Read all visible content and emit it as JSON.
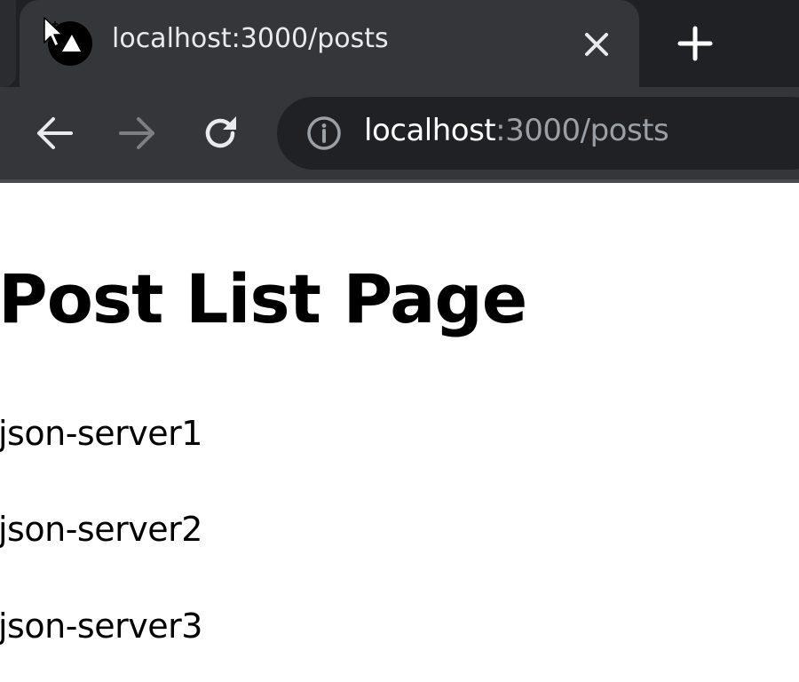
{
  "browser": {
    "tab": {
      "title": "localhost:3000/posts",
      "favicon": "nextjs-logo-icon",
      "close_icon": "close-icon"
    },
    "new_tab_icon": "plus-icon",
    "toolbar": {
      "back_icon": "arrow-left-icon",
      "forward_icon": "arrow-right-icon",
      "reload_icon": "reload-icon",
      "forward_enabled": false
    },
    "address_bar": {
      "info_icon": "info-icon",
      "host": "localhost",
      "rest": ":3000/posts"
    },
    "colors": {
      "chrome_dark": "#202124",
      "chrome_tab": "#35363a",
      "text_light": "#e8eaed",
      "url_dim": "#9aa0a6"
    }
  },
  "page": {
    "title": "Post List Page",
    "posts": [
      {
        "title": "json-server1"
      },
      {
        "title": "json-server2"
      },
      {
        "title": "json-server3"
      }
    ]
  }
}
